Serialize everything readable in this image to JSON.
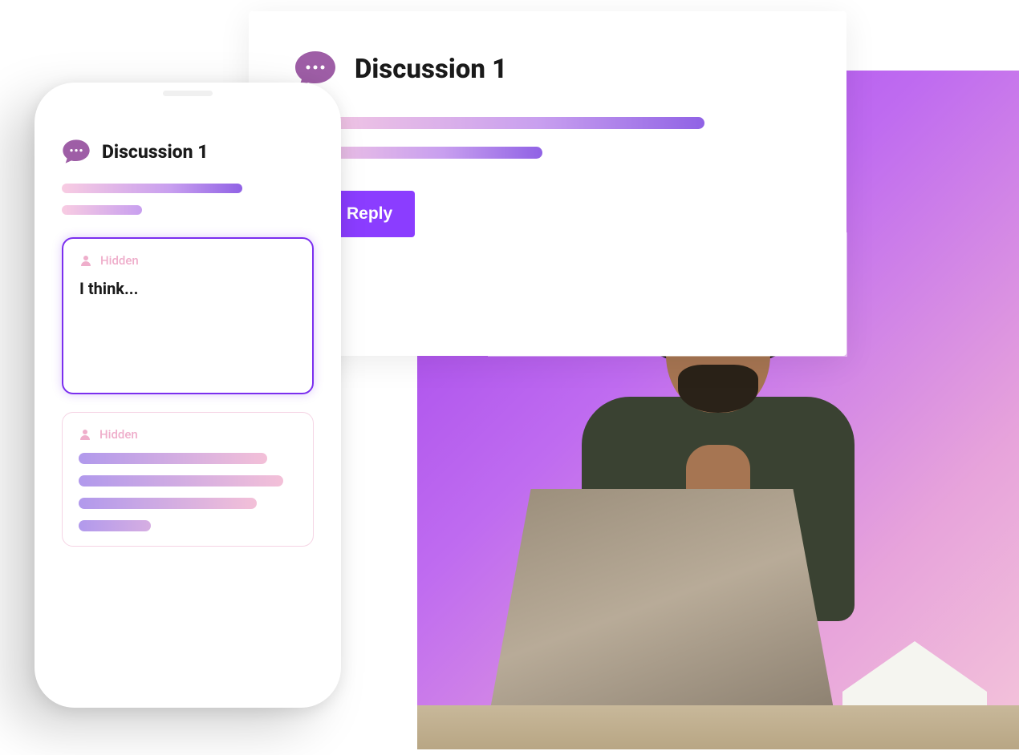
{
  "desktop": {
    "title": "Discussion 1",
    "reply_button_label": "Reply"
  },
  "phone": {
    "title": "Discussion 1",
    "replies": [
      {
        "author_label": "Hidden",
        "text": "I think...",
        "active": true
      },
      {
        "author_label": "Hidden",
        "active": false
      }
    ]
  },
  "colors": {
    "accent": "#8b3dff",
    "bubble": "#9e5ea6",
    "hidden_text": "#efaecb"
  },
  "icons": {
    "chat_bubble": "chat-bubble-icon",
    "send": "paper-plane-icon",
    "user": "user-icon"
  }
}
